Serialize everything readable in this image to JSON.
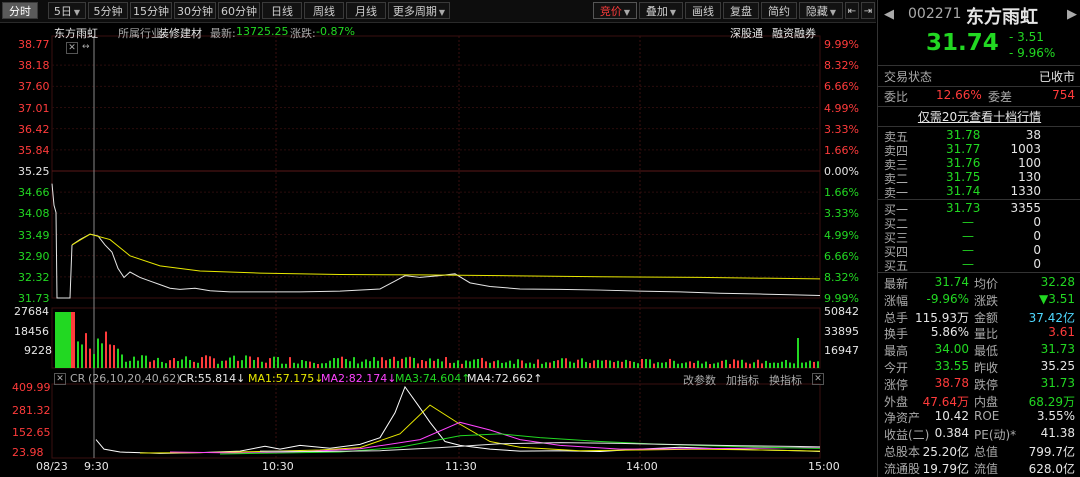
{
  "toolbar": {
    "left_buttons": [
      "分时",
      "5日",
      "5分钟",
      "15分钟",
      "30分钟",
      "60分钟",
      "日线",
      "周线",
      "月线",
      "更多周期"
    ],
    "right_buttons": [
      "竞价",
      "叠加",
      "画线",
      "复盘",
      "简约",
      "隐藏"
    ]
  },
  "header": {
    "stock_name": "东方雨虹",
    "industry_label": "所属行业:",
    "industry": "装修建材",
    "latest_label": "最新:",
    "latest_value": "13725.25",
    "change_label": "涨跌:",
    "change_value": "-0.87%",
    "shen_gu_tong": "深股通",
    "margin": "融资融券"
  },
  "price_axis": {
    "left": [
      "38.77",
      "38.18",
      "37.60",
      "37.01",
      "36.42",
      "35.84",
      "35.25",
      "34.66",
      "34.08",
      "33.49",
      "32.90",
      "32.32",
      "31.73"
    ],
    "right": [
      "9.99%",
      "8.32%",
      "6.66%",
      "4.99%",
      "3.33%",
      "1.66%",
      "0.00%",
      "1.66%",
      "3.33%",
      "4.99%",
      "6.66%",
      "8.32%",
      "9.99%"
    ]
  },
  "volume_axis": {
    "left": [
      "27684",
      "18456",
      "9228"
    ],
    "right": [
      "50842",
      "33895",
      "16947"
    ]
  },
  "indicator_bar": {
    "name": "CR",
    "params": "(26,10,20,40,62)",
    "cr": "CR:55.814↓",
    "ma1": "MA1:57.175↓",
    "ma2": "MA2:82.174↓",
    "ma3": "MA3:74.604↑",
    "ma4": "MA4:72.662↑",
    "change_param": "改参数",
    "add_indicator": "加指标",
    "switch_indicator": "换指标"
  },
  "indicator_axis": [
    "409.99",
    "281.32",
    "152.65",
    "23.98"
  ],
  "time_axis": [
    "08/23",
    "9:30",
    "10:30",
    "11:30",
    "14:00",
    "15:00"
  ],
  "colors": {
    "up": "#ff3b3b",
    "down": "#22d822",
    "price_line": "#e6e6e6",
    "avg_line": "#e8e800",
    "cr_line": "#ffffff",
    "ma1": "#e8e800",
    "ma2": "#ff44ff",
    "ma3": "#22d822",
    "ma4": "#e6e6e6"
  },
  "quote": {
    "code": "002271",
    "name": "东方雨虹",
    "price": "31.74",
    "change": "- 3.51",
    "change_pct": "- 9.96%",
    "status_label": "交易状态",
    "status_value": "已收市",
    "weibi_label": "委比",
    "weibi_value": "12.66%",
    "weicha_label": "委差",
    "weicha_value": "754",
    "upsell_text": "仅需20元查看十档行情",
    "asks": [
      {
        "label": "卖五",
        "price": "31.78",
        "vol": "38"
      },
      {
        "label": "卖四",
        "price": "31.77",
        "vol": "1003"
      },
      {
        "label": "卖三",
        "price": "31.76",
        "vol": "100"
      },
      {
        "label": "卖二",
        "price": "31.75",
        "vol": "130"
      },
      {
        "label": "卖一",
        "price": "31.74",
        "vol": "1330"
      }
    ],
    "bids": [
      {
        "label": "买一",
        "price": "31.73",
        "vol": "3355"
      },
      {
        "label": "买二",
        "price": "—",
        "vol": "0"
      },
      {
        "label": "买三",
        "price": "—",
        "vol": "0"
      },
      {
        "label": "买四",
        "price": "—",
        "vol": "0"
      },
      {
        "label": "买五",
        "price": "—",
        "vol": "0"
      }
    ],
    "stats": [
      {
        "l1": "最新",
        "v1": "31.74",
        "c1": "green",
        "l2": "均价",
        "v2": "32.28",
        "c2": "green"
      },
      {
        "l1": "涨幅",
        "v1": "-9.96%",
        "c1": "green",
        "l2": "涨跌",
        "v2": "▼3.51",
        "c2": "green"
      },
      {
        "l1": "总手",
        "v1": "115.93万",
        "c1": "white",
        "l2": "金额",
        "v2": "37.42亿",
        "c2": "cyan"
      },
      {
        "l1": "换手",
        "v1": "5.86%",
        "c1": "white",
        "l2": "量比",
        "v2": "3.61",
        "c2": "red"
      },
      {
        "l1": "最高",
        "v1": "34.00",
        "c1": "green",
        "l2": "最低",
        "v2": "31.73",
        "c2": "green"
      },
      {
        "l1": "今开",
        "v1": "33.55",
        "c1": "green",
        "l2": "昨收",
        "v2": "35.25",
        "c2": "white"
      },
      {
        "l1": "涨停",
        "v1": "38.78",
        "c1": "red",
        "l2": "跌停",
        "v2": "31.73",
        "c2": "green"
      },
      {
        "l1": "外盘",
        "v1": "47.64万",
        "c1": "red",
        "l2": "内盘",
        "v2": "68.29万",
        "c2": "green"
      },
      {
        "l1": "净资产",
        "v1": "10.42",
        "c1": "white",
        "l2": "ROE",
        "v2": "3.55%",
        "c2": "white"
      },
      {
        "l1": "收益(二)",
        "v1": "0.384",
        "c1": "white",
        "l2": "PE(动)*",
        "v2": "41.38",
        "c2": "white"
      },
      {
        "l1": "总股本",
        "v1": "25.20亿",
        "c1": "white",
        "l2": "总值",
        "v2": "799.7亿",
        "c2": "white"
      },
      {
        "l1": "流通股",
        "v1": "19.79亿",
        "c1": "white",
        "l2": "流值",
        "v2": "628.0亿",
        "c2": "white"
      }
    ]
  },
  "chart_data": {
    "type": "line",
    "x": [
      "9:30",
      "10:30",
      "11:30",
      "14:00",
      "15:00"
    ],
    "ylim": [
      31.73,
      38.77
    ],
    "series": [],
    "volume_ylim": [
      0,
      27684
    ],
    "indicator_ylim": [
      23.98,
      409.99
    ]
  }
}
